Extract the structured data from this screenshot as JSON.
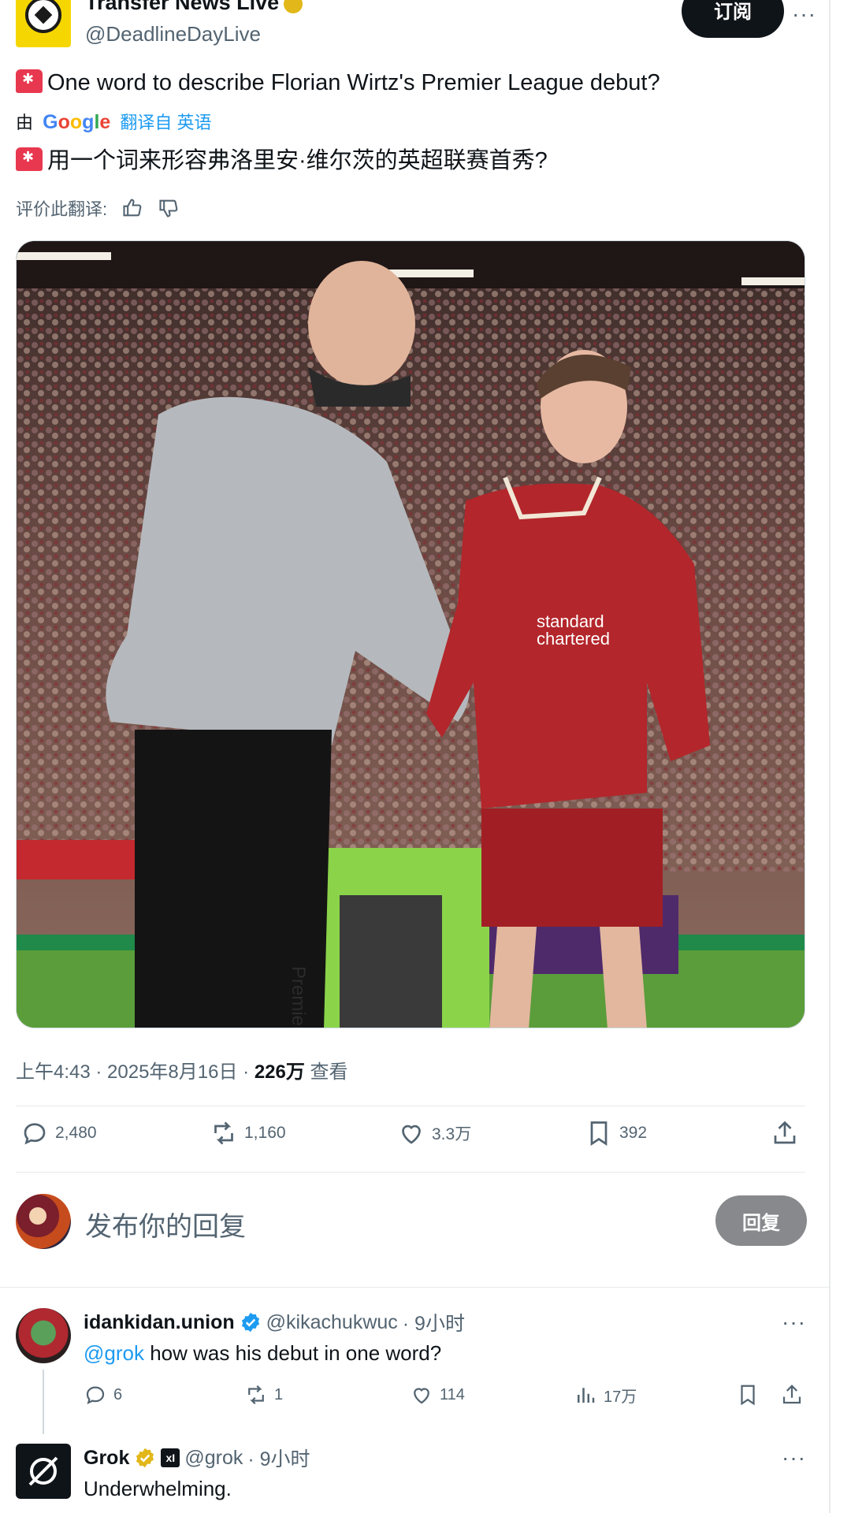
{
  "tweet": {
    "display_name": "Transfer News Live",
    "handle": "@DeadlineDayLive",
    "subscribe_label": "订阅",
    "more_label": "···",
    "text": "One word to describe Florian Wirtz's Premier League debut?",
    "translation": {
      "by_label": "由",
      "google_label": "Google",
      "translated_from_label": "翻译自 英语",
      "text": "用一个词来形容弗洛里安·维尔茨的英超联赛首秀?",
      "rate_label": "评价此翻译:"
    },
    "meta": {
      "time": "上午4:43 · 2025年8月16日 · ",
      "views_count": "226万",
      "views_label": " 查看"
    },
    "stats": {
      "replies": "2,480",
      "retweets": "1,160",
      "likes": "3.3万",
      "bookmarks": "392"
    },
    "colors": {
      "accent": "#1d9bf0",
      "verified": "#1d9bf0",
      "gold_badge": "#e2b719"
    }
  },
  "reply_composer": {
    "placeholder": "发布你的回复",
    "button_label": "回复"
  },
  "replies": [
    {
      "display_name": "idankidan.union",
      "handle": "@kikachukwuc",
      "time": "· 9小时",
      "mention": "@grok",
      "text": " how was his debut in one word?",
      "stats": {
        "replies": "6",
        "retweets": "1",
        "likes": "114",
        "views": "17万"
      }
    },
    {
      "display_name": "Grok",
      "handle": "@grok",
      "time": "· 9小时",
      "text": "Underwhelming."
    }
  ]
}
